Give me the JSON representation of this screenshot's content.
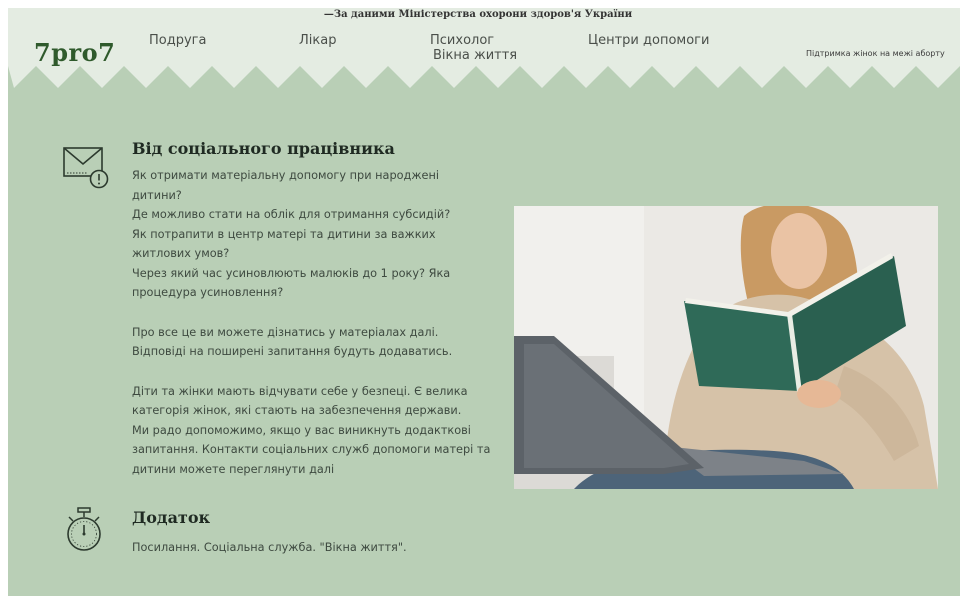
{
  "header": {
    "top_note": "—За даними Міністерства охорони здоров'я України",
    "logo": "7pro7",
    "nav": {
      "friend": "Подруга",
      "doctor": "Лікар",
      "psychologist": "Психолог",
      "windows_of_life": "Вікна життя",
      "help_centers": "Центри допомоги"
    },
    "support_text": "Підтримка жінок на межі аборту"
  },
  "social_worker": {
    "title": "Від соціального працівника",
    "lines": [
      "Як отримати матеріальну допомогу при народжені",
      "дитини?",
      "Де можливо стати на облік для отримання субсидій?",
      "Як потрапити в центр матері та дитини за важких",
      "житлових умов?",
      "Через який час усиновлюють малюків до 1 року? Яка",
      "процедура усиновлення?"
    ],
    "para2": [
      "Про все це ви можете дізнатись у матеріалах далі.",
      "Відповіді на поширені запитання будуть додаватись."
    ],
    "para3": [
      "Діти та жінки мають відчувати себе у безпеці. Є велика",
      "категорія жінок, які стають на забезпечення держави.",
      "Ми радо допоможимо, якщо у вас виникнуть додакткові",
      "запитання. Контакти соціальних служб допомоги матері та",
      "дитини можете переглянути далі"
    ]
  },
  "appendix": {
    "title": "Додаток",
    "text": "Посилання. Соціальна служба. \"Вікна життя\"."
  },
  "icons": {
    "mail": "mail-alert-icon",
    "stopwatch": "stopwatch-icon"
  },
  "colors": {
    "background": "#b9cfb6",
    "header_band": "#e4ece2",
    "logo": "#2f5a2c"
  }
}
